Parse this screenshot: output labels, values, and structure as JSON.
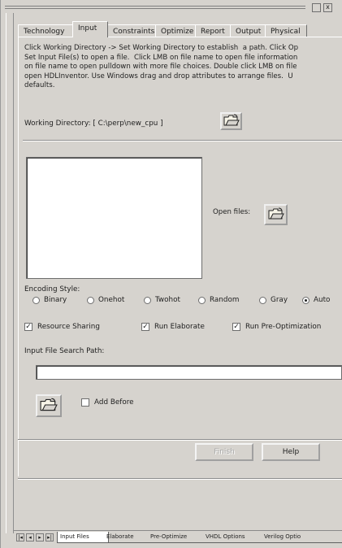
{
  "window": {
    "close_glyph": "x"
  },
  "tabs": [
    "Technology",
    "Input",
    "Constraints",
    "Optimize",
    "Report",
    "Output",
    "Physical"
  ],
  "active_tab": "Input",
  "instructions": "Click Working Directory -> Set Working Directory to establish  a path. Click Op\nSet Input File(s) to open a file.  Click LMB on file name to open file information\non file name to open pulldown with more file choices. Double click LMB on file\nopen HDLInventor. Use Windows drag and drop attributes to arrange files.  U\ndefaults.",
  "working_directory": {
    "label": "Working Directory: [ C:\\perp\\new_cpu ]",
    "button_icon": "open-folder-icon"
  },
  "files": {
    "items": [],
    "open_label": "Open files:",
    "button_icon": "open-folder-icon"
  },
  "encoding": {
    "label": "Encoding Style:",
    "options": [
      "Binary",
      "Onehot",
      "Twohot",
      "Random",
      "Gray",
      "Auto"
    ],
    "selected": "Auto"
  },
  "options": {
    "resource_sharing": {
      "label": "Resource Sharing",
      "checked": true
    },
    "run_elaborate": {
      "label": "Run Elaborate",
      "checked": true
    },
    "run_preopt": {
      "label": "Run Pre-Optimization",
      "checked": true
    }
  },
  "search": {
    "label": "Input File Search Path:",
    "value": "",
    "add_before_label": "Add Before",
    "add_before_checked": false
  },
  "buttons": {
    "finish": "Finish",
    "help": "Help"
  },
  "bottom_tabs": [
    "Input Files",
    "Elaborate",
    "Pre-Optimize",
    "VHDL Options",
    "Verilog Optio"
  ],
  "bottom_active": "Input Files",
  "nav_glyphs": [
    "|◂",
    "◂",
    "▸",
    "▸|"
  ]
}
